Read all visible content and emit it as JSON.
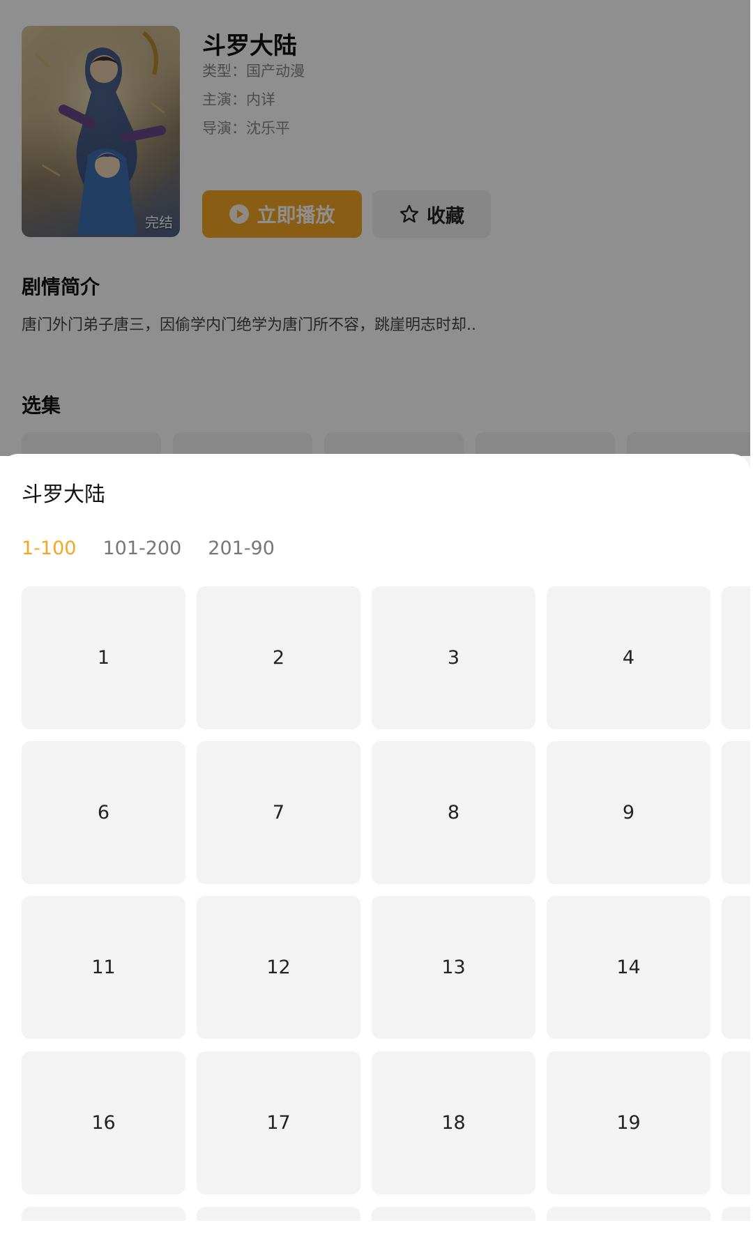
{
  "detail": {
    "title": "斗罗大陆",
    "type": "类型：国产动漫",
    "cast": "主演：内详",
    "director": "导演：沈乐平",
    "poster_badge": "完结",
    "play_label": "立即播放",
    "fav_label": "收藏",
    "plot_heading": "剧情简介",
    "plot_text": "唐门外门弟子唐三，因偷学内门绝学为唐门所不容，跳崖明志时却..",
    "episodes_heading": "选集"
  },
  "sheet": {
    "title": "斗罗大陆",
    "tabs": [
      {
        "label": "1-100",
        "active": true
      },
      {
        "label": "101-200",
        "active": false
      },
      {
        "label": "201-90",
        "active": false
      }
    ],
    "episodes": [
      "1",
      "2",
      "3",
      "4",
      "6",
      "7",
      "8",
      "9",
      "11",
      "12",
      "13",
      "14",
      "16",
      "17",
      "18",
      "19"
    ]
  },
  "colors": {
    "accent": "#f5a623",
    "cell_bg": "#f3f3f3",
    "overlay": "rgba(0,0,0,0.44)"
  },
  "icons": {
    "play": "play-circle-icon",
    "favorite": "star-outline-icon"
  }
}
